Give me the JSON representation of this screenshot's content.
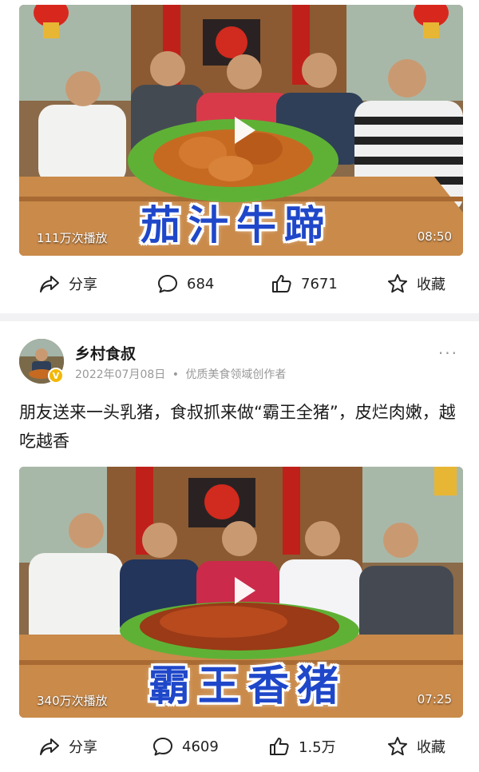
{
  "posts": [
    {
      "video": {
        "views": "111万次播放",
        "duration": "08:50",
        "caption": "茄汁牛蹄"
      },
      "actions": {
        "share": "分享",
        "comments": "684",
        "likes": "7671",
        "favorite": "收藏"
      }
    },
    {
      "author": {
        "name": "乡村食叔",
        "date": "2022年07月08日",
        "separator": "•",
        "role": "优质美食领域创作者",
        "verified_badge": "V"
      },
      "more": "···",
      "text": "朋友送来一头乳猪，食叔抓来做“霸王全猪”，皮烂肉嫩，越吃越香",
      "video": {
        "views": "340万次播放",
        "duration": "07:25",
        "caption": "霸王香猪"
      },
      "actions": {
        "share": "分享",
        "comments": "4609",
        "likes": "1.5万",
        "favorite": "收藏"
      }
    }
  ],
  "icons": {
    "share": "share-arrow-icon",
    "comment": "comment-bubble-icon",
    "like": "thumbs-up-icon",
    "favorite": "star-icon",
    "play": "play-icon"
  },
  "colors": {
    "caption_blue": "#1f47c9",
    "divider": "#f2f2f4",
    "meta_gray": "#999999",
    "badge_gold": "#f2b807"
  }
}
